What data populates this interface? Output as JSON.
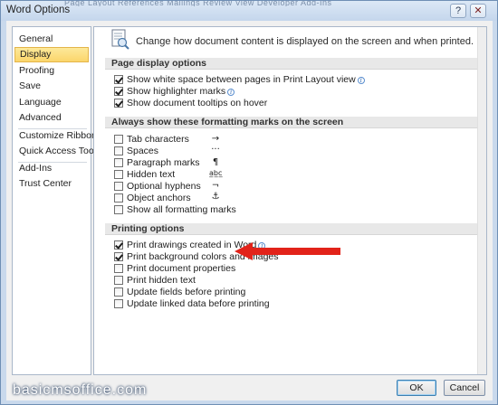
{
  "window": {
    "title": "Word Options",
    "background_menu_text": "Page Layout   References   Mailings   Review   View   Developer   Add-Ins",
    "help_icon": "question-mark-icon",
    "close_icon": "close-x-icon"
  },
  "nav": {
    "items": [
      {
        "label": "General"
      },
      {
        "label": "Display"
      },
      {
        "label": "Proofing"
      },
      {
        "label": "Save"
      },
      {
        "label": "Language"
      },
      {
        "label": "Advanced"
      },
      {
        "label": "Customize Ribbon"
      },
      {
        "label": "Quick Access Toolbar"
      },
      {
        "label": "Add-Ins"
      },
      {
        "label": "Trust Center"
      }
    ],
    "selected": "Display"
  },
  "header": {
    "icon": "display-page-icon",
    "text": "Change how document content is displayed on the screen and when printed."
  },
  "sections": {
    "page_display": {
      "title": "Page display options",
      "options": [
        {
          "label": "Show white space between pages in Print Layout view",
          "checked": true,
          "info": true
        },
        {
          "label": "Show highlighter marks",
          "checked": true,
          "info": true
        },
        {
          "label": "Show document tooltips on hover",
          "checked": true,
          "info": false
        }
      ]
    },
    "formatting_marks": {
      "title": "Always show these formatting marks on the screen",
      "options": [
        {
          "label": "Tab characters",
          "checked": false,
          "mark": "→"
        },
        {
          "label": "Spaces",
          "checked": false,
          "mark": "···"
        },
        {
          "label": "Paragraph marks",
          "checked": false,
          "mark": "¶"
        },
        {
          "label": "Hidden text",
          "checked": false,
          "mark": "a̲b̲c̲"
        },
        {
          "label": "Optional hyphens",
          "checked": false,
          "mark": "¬"
        },
        {
          "label": "Object anchors",
          "checked": false,
          "mark": "⚓"
        },
        {
          "label": "Show all formatting marks",
          "checked": false,
          "mark": ""
        }
      ]
    },
    "printing": {
      "title": "Printing options",
      "options": [
        {
          "label": "Print drawings created in Word",
          "checked": true,
          "info": true
        },
        {
          "label": "Print background colors and images",
          "checked": true,
          "info": false
        },
        {
          "label": "Print document properties",
          "checked": false,
          "info": false
        },
        {
          "label": "Print hidden text",
          "checked": false,
          "info": false
        },
        {
          "label": "Update fields before printing",
          "checked": false,
          "info": false
        },
        {
          "label": "Update linked data before printing",
          "checked": false,
          "info": false
        }
      ]
    }
  },
  "annotation": {
    "arrow_color": "#e2231a",
    "points_to": "Print background colors and images"
  },
  "buttons": {
    "ok": "OK",
    "cancel": "Cancel"
  },
  "watermark": "basicmsoffice.com",
  "colors": {
    "selected_nav": "#fbd56b",
    "window_frame": "#c9d9ec",
    "section_header": "#e8e8e8"
  }
}
